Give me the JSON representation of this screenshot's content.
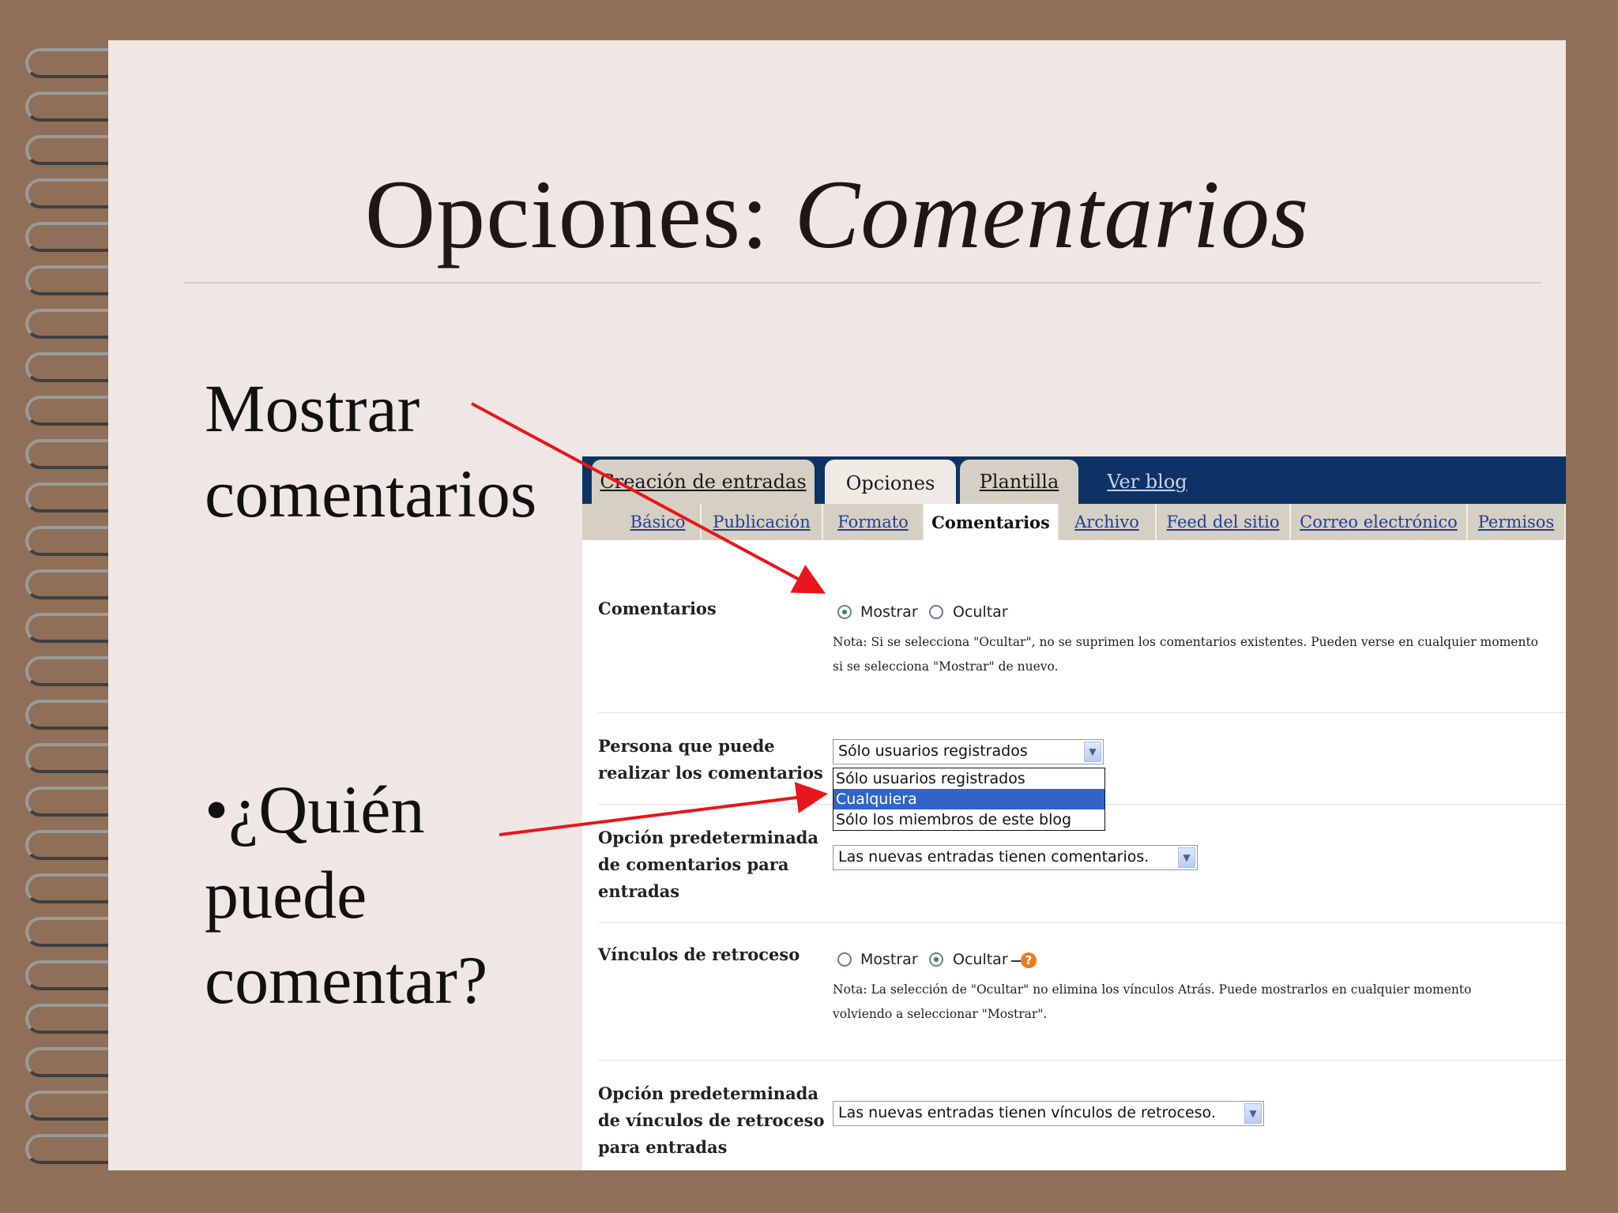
{
  "slide": {
    "title_plain": "Opciones: ",
    "title_italic": "Comentarios",
    "left_text_1": [
      "Mostrar",
      "comentarios"
    ],
    "left_text_2": [
      "•¿Quién",
      "puede",
      "comentar?"
    ]
  },
  "top_tabs": [
    {
      "label": "Creación de entradas"
    },
    {
      "label": "Opciones"
    },
    {
      "label": "Plantilla"
    },
    {
      "label": "Ver blog"
    }
  ],
  "sub_tabs": [
    {
      "label": "Básico"
    },
    {
      "label": "Publicación"
    },
    {
      "label": "Formato"
    },
    {
      "label": "Comentarios"
    },
    {
      "label": "Archivo"
    },
    {
      "label": "Feed del sitio"
    },
    {
      "label": "Correo electrónico"
    },
    {
      "label": "Permisos"
    }
  ],
  "settings": {
    "comments": {
      "label": "Comentarios",
      "option_show": "Mostrar",
      "option_hide": "Ocultar",
      "selected": "Mostrar",
      "note_1": "Nota: Si se selecciona \"Ocultar\", no se suprimen los comentarios existentes. Pueden verse en cualquier momento",
      "note_2": "si se selecciona \"Mostrar\" de nuevo."
    },
    "who_can_comment": {
      "label_1": "Persona que puede",
      "label_2": "realizar los comentarios",
      "value": "Sólo usuarios registrados",
      "options": [
        "Sólo usuarios registrados",
        "Cualquiera",
        "Sólo los miembros de este blog"
      ],
      "highlighted": "Cualquiera"
    },
    "default_comments": {
      "label_1": "Opción predeterminada",
      "label_2": "de comentarios para",
      "label_3": "entradas",
      "value": "Las nuevas entradas tienen comentarios."
    },
    "backlinks": {
      "label": "Vínculos de retroceso",
      "option_show": "Mostrar",
      "option_hide": "Ocultar",
      "selected": "Ocultar",
      "help": "?",
      "note_1": "Nota: La selección de \"Ocultar\" no elimina los vínculos Atrás. Puede mostrarlos en cualquier momento",
      "note_2": "volviendo a seleccionar \"Mostrar\"."
    },
    "default_backlinks": {
      "label_1": "Opción predeterminada",
      "label_2": "de vínculos de retroceso",
      "label_3": "para entradas",
      "value": "Las nuevas entradas tienen vínculos de retroceso."
    }
  },
  "colors": {
    "background": "#8f6f58",
    "slide": "#efe7e3",
    "topbar": "#0d3366",
    "arrow": "#e8161a",
    "highlight": "#3264c8"
  }
}
